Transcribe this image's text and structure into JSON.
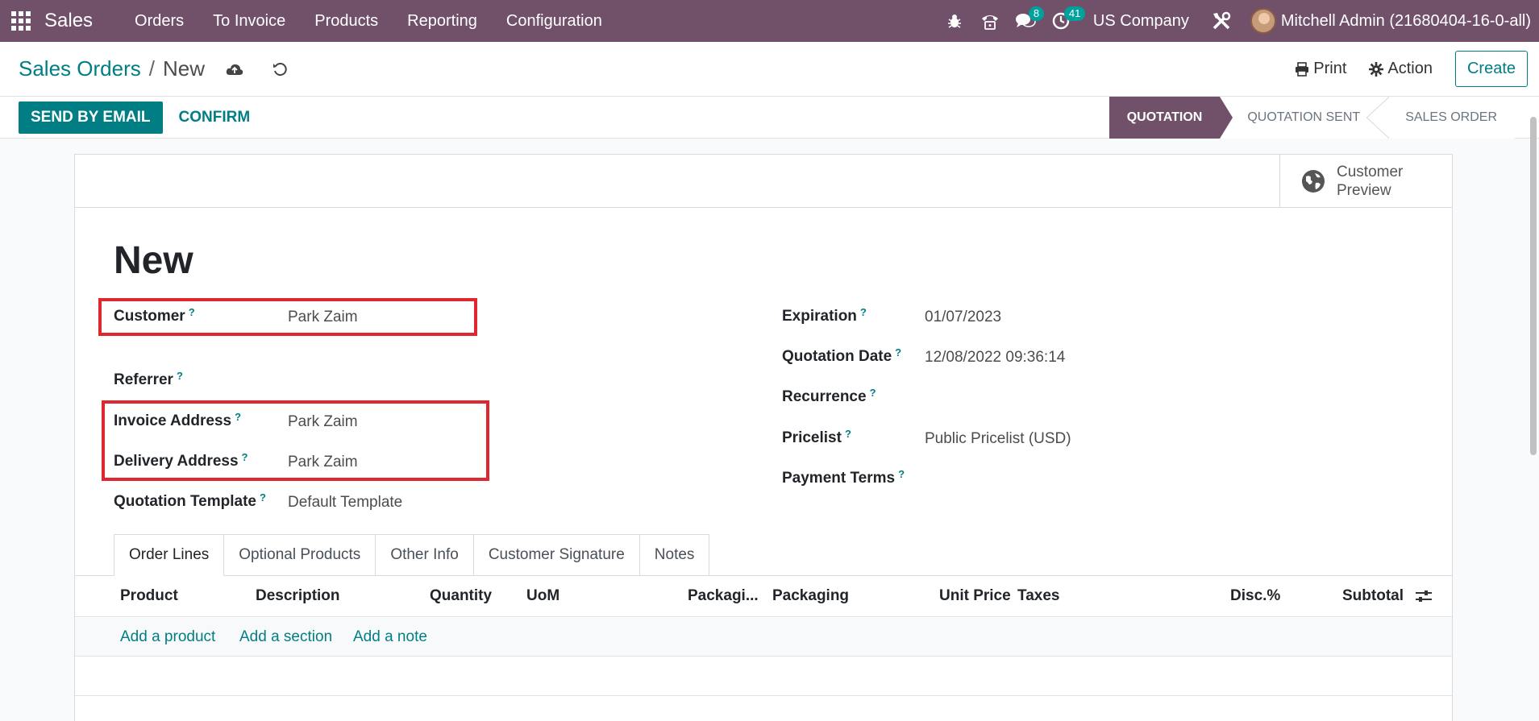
{
  "navbar": {
    "app_name": "Sales",
    "menu": [
      "Orders",
      "To Invoice",
      "Products",
      "Reporting",
      "Configuration"
    ],
    "messages_badge": "8",
    "activities_badge": "41",
    "company": "US Company",
    "user": "Mitchell Admin (21680404-16-0-all)",
    "bg_color": "#71506a"
  },
  "control": {
    "breadcrumb_parent": "Sales Orders",
    "breadcrumb_sep": "/",
    "breadcrumb_current": "New",
    "print_label": "Print",
    "action_label": "Action",
    "create_label": "Create"
  },
  "statusbar": {
    "send_email_label": "SEND BY EMAIL",
    "confirm_label": "CONFIRM",
    "stages": [
      "QUOTATION",
      "QUOTATION SENT",
      "SALES ORDER"
    ],
    "active_stage": "QUOTATION"
  },
  "sheet": {
    "customer_preview_label": "Customer Preview",
    "title": "New",
    "left_fields": [
      {
        "label": "Customer",
        "value": "Park Zaim"
      },
      {
        "label": "Referrer",
        "value": ""
      },
      {
        "label": "Invoice Address",
        "value": "Park Zaim"
      },
      {
        "label": "Delivery Address",
        "value": "Park Zaim"
      },
      {
        "label": "Quotation Template",
        "value": "Default Template"
      }
    ],
    "right_fields": [
      {
        "label": "Expiration",
        "value": "01/07/2023"
      },
      {
        "label": "Quotation Date",
        "value": "12/08/2022 09:36:14"
      },
      {
        "label": "Recurrence",
        "value": ""
      },
      {
        "label": "Pricelist",
        "value": "Public Pricelist (USD)"
      },
      {
        "label": "Payment Terms",
        "value": ""
      }
    ],
    "help_marker": "?",
    "tabs": [
      "Order Lines",
      "Optional Products",
      "Other Info",
      "Customer Signature",
      "Notes"
    ],
    "active_tab": "Order Lines",
    "columns": [
      "Product",
      "Description",
      "Quantity",
      "UoM",
      "Packagi...",
      "Packaging",
      "Unit Price",
      "Taxes",
      "Disc.%",
      "Subtotal"
    ],
    "add_links": [
      "Add a product",
      "Add a section",
      "Add a note"
    ]
  },
  "colors": {
    "accent": "#017e84",
    "highlight": "#e0262f"
  }
}
